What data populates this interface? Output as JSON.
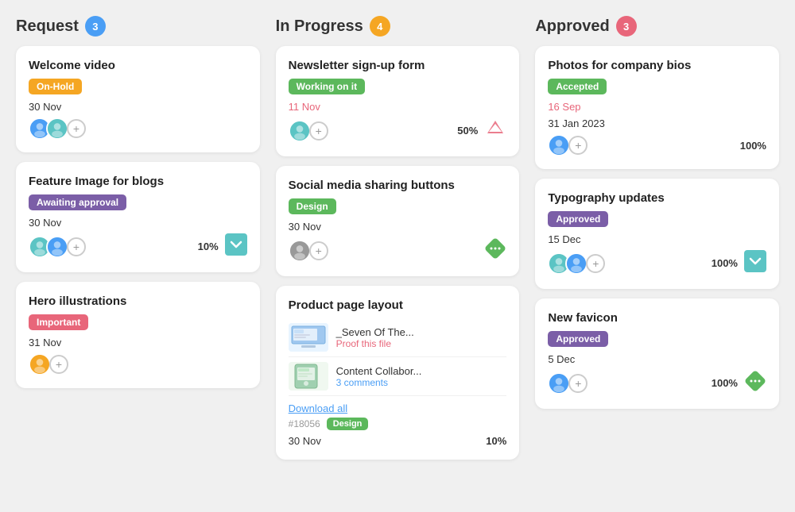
{
  "columns": [
    {
      "id": "request",
      "title": "Request",
      "badge": "3",
      "badge_color": "badge-blue",
      "cards": [
        {
          "id": "welcome-video",
          "title": "Welcome video",
          "tag": "On-Hold",
          "tag_class": "tag-onhold",
          "date": "30 Nov",
          "date_red": false,
          "avatars": [
            "blue",
            "teal"
          ],
          "show_add": true,
          "percent": null,
          "icon": null
        },
        {
          "id": "feature-image",
          "title": "Feature Image for blogs",
          "tag": "Awaiting approval",
          "tag_class": "tag-awaiting",
          "date": "30 Nov",
          "date_red": false,
          "avatars": [
            "teal",
            "blue"
          ],
          "show_add": true,
          "percent": "10%",
          "icon": "chevron-down-teal"
        },
        {
          "id": "hero-illustrations",
          "title": "Hero illustrations",
          "tag": "Important",
          "tag_class": "tag-important",
          "date": "31 Nov",
          "date_red": false,
          "avatars": [
            "orange"
          ],
          "show_add": true,
          "percent": null,
          "icon": null
        }
      ]
    },
    {
      "id": "in-progress",
      "title": "In Progress",
      "badge": "4",
      "badge_color": "badge-yellow",
      "cards": [
        {
          "id": "newsletter",
          "title": "Newsletter sign-up form",
          "tag": "Working on it",
          "tag_class": "tag-working",
          "date": "11 Nov",
          "date_red": true,
          "avatars": [
            "teal"
          ],
          "show_add": true,
          "percent": "50%",
          "icon": "arrow-up-red",
          "type": "normal"
        },
        {
          "id": "social-media",
          "title": "Social media sharing buttons",
          "tag": "Design",
          "tag_class": "tag-design",
          "date": "30 Nov",
          "date_red": false,
          "avatars": [
            "gray"
          ],
          "show_add": true,
          "percent": null,
          "icon": "dots-diamond-green",
          "type": "normal"
        },
        {
          "id": "product-page",
          "title": "Product page layout",
          "tag": null,
          "tag_class": null,
          "date": "30 Nov",
          "date_red": false,
          "avatars": [],
          "show_add": false,
          "percent": "10%",
          "icon": null,
          "type": "files",
          "files": [
            {
              "name": "_Seven Of The...",
              "action": "Proof this file",
              "thumb_type": "desktop"
            },
            {
              "name": "Content Collabor...",
              "action": "3 comments",
              "action_color": "blue",
              "thumb_type": "tablet"
            }
          ],
          "download_label": "Download all",
          "hash": "#18056",
          "file_tag": "Design",
          "file_tag_class": "tag-design"
        }
      ]
    },
    {
      "id": "approved",
      "title": "Approved",
      "badge": "3",
      "badge_color": "badge-pink",
      "cards": [
        {
          "id": "photos-company",
          "title": "Photos for company bios",
          "tag": "Accepted",
          "tag_class": "tag-accepted",
          "date": "16 Sep",
          "date_red": true,
          "date2": "31 Jan 2023",
          "avatars": [
            "blue"
          ],
          "show_add": true,
          "percent": "100%",
          "icon": null
        },
        {
          "id": "typography",
          "title": "Typography updates",
          "tag": "Approved",
          "tag_class": "tag-approved",
          "date": "15 Dec",
          "date_red": false,
          "avatars": [
            "teal",
            "blue"
          ],
          "show_add": true,
          "percent": "100%",
          "icon": "chevron-down-teal"
        },
        {
          "id": "new-favicon",
          "title": "New favicon",
          "tag": "Approved",
          "tag_class": "tag-approved",
          "date": "5 Dec",
          "date_red": false,
          "avatars": [
            "blue"
          ],
          "show_add": true,
          "percent": "100%",
          "icon": "dots-diamond-green"
        }
      ]
    }
  ]
}
